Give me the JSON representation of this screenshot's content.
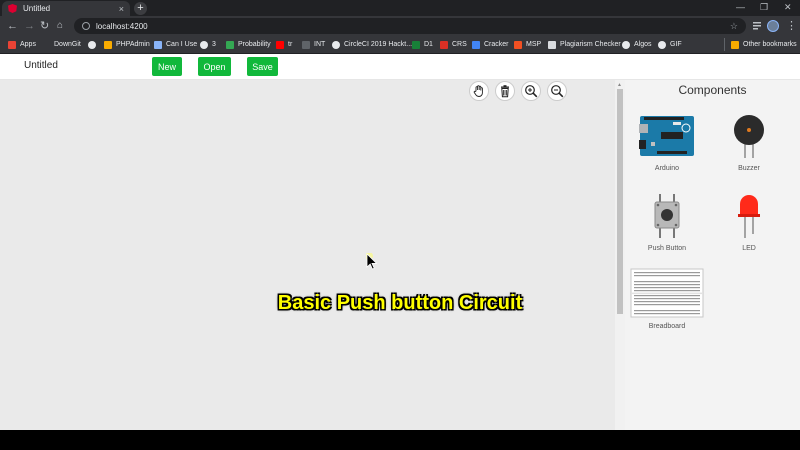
{
  "browser": {
    "tab_title": "Untitled",
    "tab_close": "×",
    "new_tab": "+",
    "window_controls": [
      "—",
      "❐",
      "✕"
    ],
    "url": "localhost:4200",
    "bookmarks": [
      {
        "label": "Apps",
        "color": "#ea4335"
      },
      {
        "label": "DownGit",
        "color": "#5f6368"
      },
      {
        "label": "PHPAdmin",
        "color": "#f9ab00"
      },
      {
        "label": "Can I Use",
        "color": "#8ab4f8"
      },
      {
        "label": "3",
        "color": "#e8eaed"
      },
      {
        "label": "Probability",
        "color": "#34a853"
      },
      {
        "label": "tr",
        "color": "#ff0000"
      },
      {
        "label": "INT",
        "color": "#5f6368"
      },
      {
        "label": "CircleCI 2019 Hackt...",
        "color": "#e8eaed"
      },
      {
        "label": "D1",
        "color": "#188038"
      },
      {
        "label": "CRS",
        "color": "#d93025"
      },
      {
        "label": "Cracker",
        "color": "#4285f4"
      },
      {
        "label": "MSP",
        "color": "#f25022"
      },
      {
        "label": "Plagiarism Checker",
        "color": "#dadce0"
      },
      {
        "label": "Algos",
        "color": "#e8eaed"
      },
      {
        "label": "GIF",
        "color": "#e8eaed"
      }
    ],
    "other_bookmarks": "Other bookmarks"
  },
  "header": {
    "title": "Untitled",
    "buttons": {
      "new": "New",
      "open": "Open",
      "save": "Save"
    }
  },
  "workspace": {
    "tools": [
      "hand-icon",
      "trash-icon",
      "zoom-in-icon",
      "zoom-out-icon"
    ],
    "caption": "Basic Push button Circuit"
  },
  "components": {
    "title": "Components",
    "items": [
      {
        "label": "Arduino"
      },
      {
        "label": "Buzzer"
      },
      {
        "label": "Push Button"
      },
      {
        "label": "LED"
      },
      {
        "label": "Breadboard"
      }
    ]
  },
  "colors": {
    "accent": "#11b83b",
    "caption": "#ffff00",
    "workspace_bg": "#eaeaea"
  }
}
